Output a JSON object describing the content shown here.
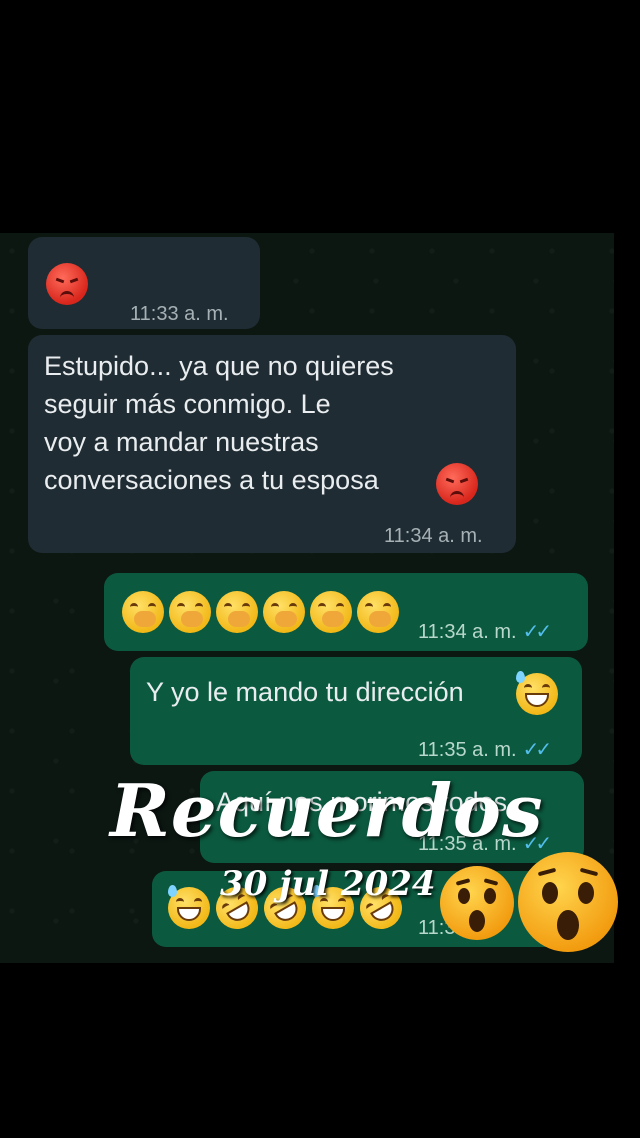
{
  "chat": {
    "messages": [
      {
        "direction": "incoming",
        "emoji": [
          "angry-face-icon"
        ],
        "time": "11:33 a. m."
      },
      {
        "direction": "incoming",
        "text": "Estupido... ya que no quieres\nseguir más conmigo. Le\nvoy a mandar nuestras\nconversaciones a tu esposa",
        "emoji": [
          "angry-face-icon"
        ],
        "time": "11:34 a. m."
      },
      {
        "direction": "outgoing",
        "emoji": [
          "hand-over-mouth-icon",
          "hand-over-mouth-icon",
          "hand-over-mouth-icon",
          "hand-over-mouth-icon",
          "hand-over-mouth-icon",
          "hand-over-mouth-icon"
        ],
        "time": "11:34 a. m.",
        "ticks": "✓✓"
      },
      {
        "direction": "outgoing",
        "text": "Y yo le mando tu dirección",
        "emoji": [
          "grinning-sweat-icon"
        ],
        "time": "11:35 a. m.",
        "ticks": "✓✓"
      },
      {
        "direction": "outgoing",
        "text": "Aquí nos morimos todos.",
        "time": "11:35 a. m.",
        "ticks": "✓✓"
      },
      {
        "direction": "outgoing",
        "emoji": [
          "grinning-sweat-icon",
          "rolling-laughing-icon",
          "rolling-laughing-icon",
          "grinning-sweat-icon",
          "rolling-laughing-icon"
        ],
        "time": "11:3"
      }
    ]
  },
  "overlay": {
    "title": "Recuerdos",
    "date": "30 jul 2024",
    "stickers": [
      "astonished-face-icon",
      "astonished-face-icon"
    ]
  },
  "colors": {
    "incoming_bubble": "#1f2c33",
    "outgoing_bubble": "#0b5a3f",
    "read_ticks": "#53bdeb",
    "background": "#0c1712"
  }
}
